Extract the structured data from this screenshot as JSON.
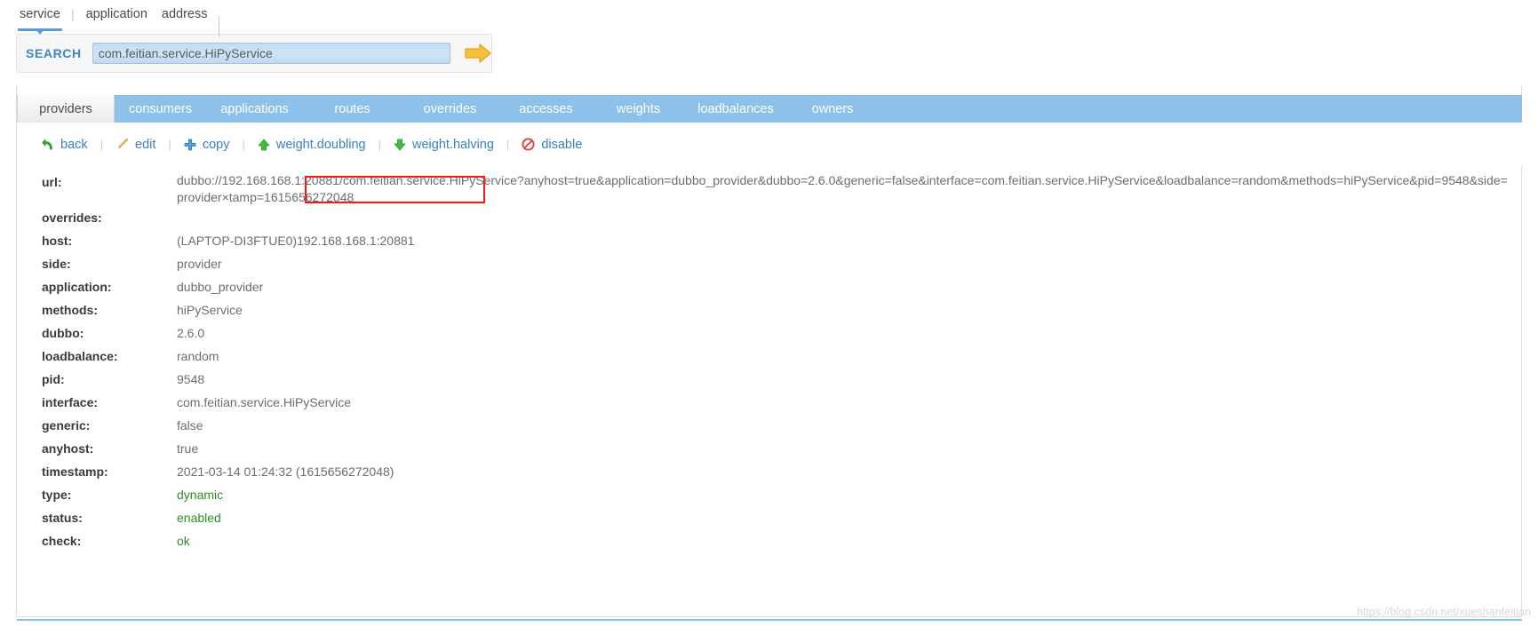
{
  "topnav": {
    "items": [
      {
        "label": "service",
        "active": true
      },
      {
        "label": "application",
        "active": false
      },
      {
        "label": "address",
        "active": false
      }
    ],
    "separator": "|"
  },
  "search": {
    "label": "SEARCH",
    "value": "com.feitian.service.HiPyService",
    "placeholder": "",
    "go_icon": "arrow-right-icon"
  },
  "tabs": [
    {
      "label": "providers",
      "active": true
    },
    {
      "label": "consumers",
      "active": false
    },
    {
      "label": "applications",
      "active": false
    },
    {
      "label": "routes",
      "active": false
    },
    {
      "label": "overrides",
      "active": false
    },
    {
      "label": "accesses",
      "active": false
    },
    {
      "label": "weights",
      "active": false
    },
    {
      "label": "loadbalances",
      "active": false
    },
    {
      "label": "owners",
      "active": false
    }
  ],
  "toolbar": {
    "separator": "|",
    "actions": [
      {
        "label": "back",
        "icon": "back-arrow-icon"
      },
      {
        "label": "edit",
        "icon": "pencil-icon"
      },
      {
        "label": "copy",
        "icon": "plus-icon"
      },
      {
        "label": "weight.doubling",
        "icon": "arrow-up-icon"
      },
      {
        "label": "weight.halving",
        "icon": "arrow-down-icon"
      },
      {
        "label": "disable",
        "icon": "forbidden-icon"
      }
    ]
  },
  "details": {
    "url": {
      "key": "url:",
      "value": "dubbo://192.168.168.1:20881/com.feitian.service.HiPyService?anyhost=true&application=dubbo_provider&dubbo=2.6.0&generic=false&interface=com.feitian.service.HiPyService&loadbalance=random&methods=hiPyService&pid=9548&side=provider×tamp=1615656272048"
    },
    "rows": [
      {
        "key": "overrides:",
        "value": "",
        "style": "plain"
      },
      {
        "key": "host:",
        "value": "(LAPTOP-DI3FTUE0)192.168.168.1:20881",
        "style": "plain"
      },
      {
        "key": "side:",
        "value": "provider",
        "style": "plain"
      },
      {
        "key": "application:",
        "value": "dubbo_provider",
        "style": "plain"
      },
      {
        "key": "methods:",
        "value": "hiPyService",
        "style": "plain"
      },
      {
        "key": "dubbo:",
        "value": "2.6.0",
        "style": "plain"
      },
      {
        "key": "loadbalance:",
        "value": "random",
        "style": "plain"
      },
      {
        "key": "pid:",
        "value": "9548",
        "style": "plain"
      },
      {
        "key": "interface:",
        "value": "com.feitian.service.HiPyService",
        "style": "plain"
      },
      {
        "key": "generic:",
        "value": "false",
        "style": "plain"
      },
      {
        "key": "anyhost:",
        "value": "true",
        "style": "plain"
      },
      {
        "key": "timestamp:",
        "value": "2021-03-14 01:24:32 (1615656272048)",
        "style": "plain"
      },
      {
        "key": "type:",
        "value": "dynamic",
        "style": "green"
      },
      {
        "key": "status:",
        "value": "enabled",
        "style": "green"
      },
      {
        "key": "check:",
        "value": "ok",
        "style": "green"
      }
    ]
  },
  "annotation": {
    "name": "red-highlight-box"
  },
  "watermark": {
    "text": "https://blog.csdn.net/xueshanfeitian"
  },
  "colors": {
    "accent": "#8ec1ea",
    "link": "#3b7fc4",
    "annotation": "#ee1c1c",
    "green": "#2e8b2e"
  }
}
